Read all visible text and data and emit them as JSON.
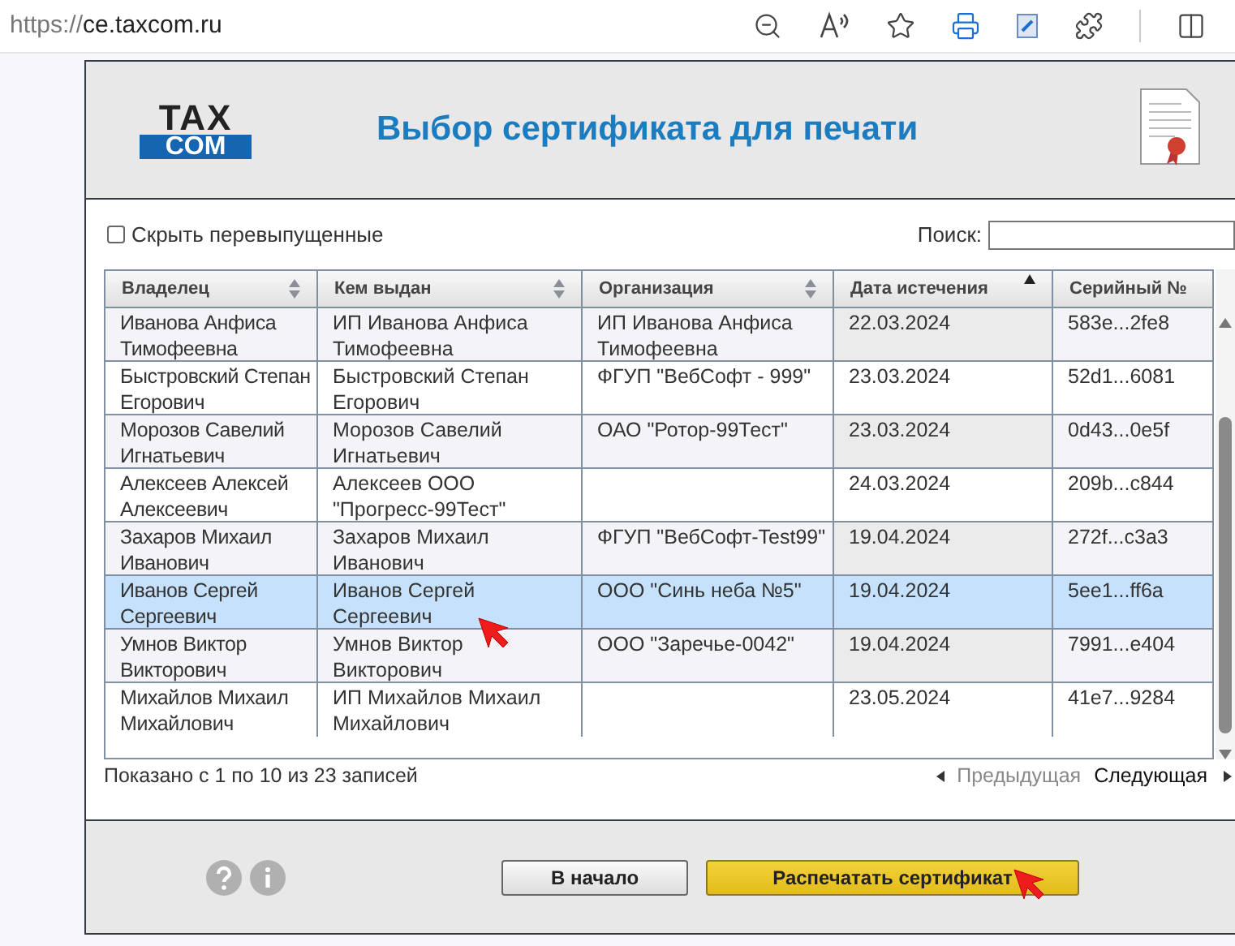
{
  "address_bar": {
    "url_scheme": "https://",
    "url_host": "ce.taxcom.ru"
  },
  "header": {
    "logo_top": "TAX",
    "logo_bottom": "COM",
    "title": "Выбор сертификата для печати"
  },
  "filter": {
    "label": "Скрыть перевыпущенные",
    "checked": false
  },
  "search": {
    "label": "Поиск:"
  },
  "table": {
    "columns": [
      {
        "label": "Владелец",
        "sortable": true,
        "sorted_ascending": false
      },
      {
        "label": "Кем выдан",
        "sortable": true,
        "sorted_ascending": false
      },
      {
        "label": "Организация",
        "sortable": true,
        "sorted_ascending": false
      },
      {
        "label": "Дата истечения",
        "sortable": true,
        "sorted_ascending": true
      },
      {
        "label": "Серийный №",
        "sortable": false,
        "sorted_ascending": false
      }
    ],
    "rows": [
      {
        "cells": [
          "Иванова Анфиса Тимофеевна",
          "ИП Иванова Анфиса Тимофеевна",
          "ИП Иванова Анфиса Тимофеевна",
          "22.03.2024",
          "583e...2fe8"
        ],
        "selected": false
      },
      {
        "cells": [
          "Быстровский Степан Егорович",
          "Быстровский Степан Егорович",
          "ФГУП \"ВебСофт - 999\"",
          "23.03.2024",
          "52d1...6081"
        ],
        "selected": false
      },
      {
        "cells": [
          "Морозов Савелий Игнатьевич",
          "Морозов Савелий Игнатьевич",
          "ОАО \"Ротор-99Тест\"",
          "23.03.2024",
          "0d43...0e5f"
        ],
        "selected": false
      },
      {
        "cells": [
          "Алексеев Алексей Алексеевич",
          "Алексеев ООО \"Прогресс-99Тест\"",
          "",
          "24.03.2024",
          "209b...c844"
        ],
        "selected": false
      },
      {
        "cells": [
          "Захаров Михаил Иванович",
          "Захаров Михаил Иванович",
          "ФГУП \"ВебСофт-Test99\"",
          "19.04.2024",
          "272f...c3a3"
        ],
        "selected": false
      },
      {
        "cells": [
          "Иванов Сергей Сергеевич",
          "Иванов Сергей Сергеевич",
          "ООО \"Синь неба №5\"",
          "19.04.2024",
          "5ee1...ff6a"
        ],
        "selected": true
      },
      {
        "cells": [
          "Умнов Виктор Викторович",
          "Умнов Виктор Викторович",
          "ООО \"Заречье-0042\"",
          "19.04.2024",
          "7991...e404"
        ],
        "selected": false
      },
      {
        "cells": [
          "Михайлов Михаил Михайлович",
          "ИП Михайлов Михаил Михайлович",
          "",
          "23.05.2024",
          "41e7...9284"
        ],
        "selected": false
      }
    ]
  },
  "info": "Показано с 1 по 10 из 23 записей",
  "pagination": [
    {
      "label": "Предыдущая",
      "disabled": true
    },
    {
      "label": "Следующая",
      "disabled": false
    }
  ],
  "buttons": [
    {
      "label": "В начало",
      "kind": "secondary"
    },
    {
      "label": "Распечатать сертификат",
      "kind": "primary"
    }
  ]
}
